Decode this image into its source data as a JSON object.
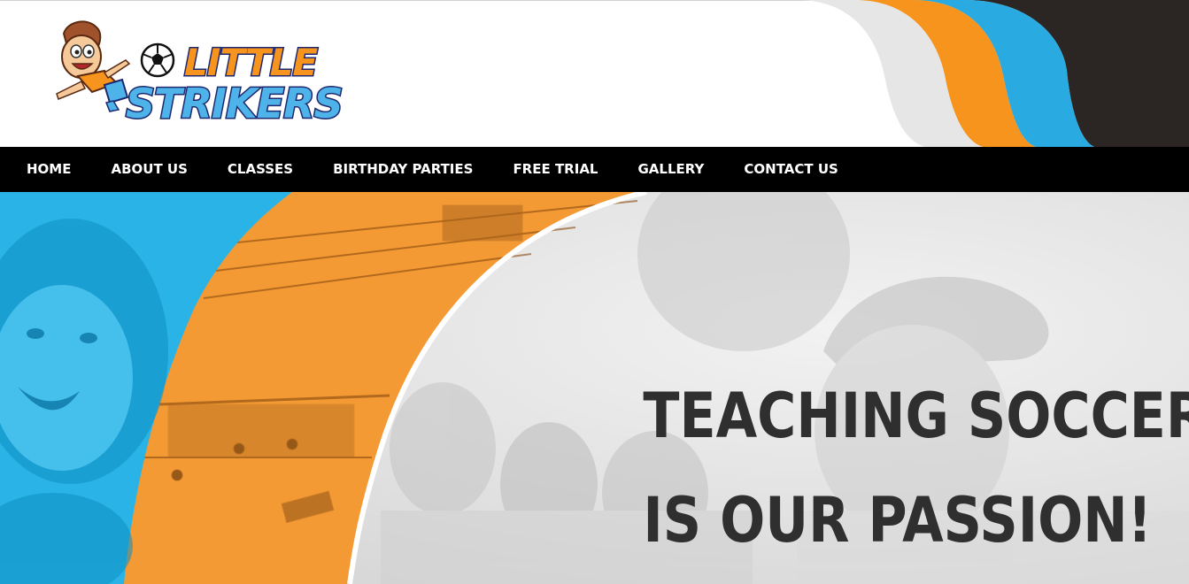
{
  "brand": {
    "logo_line1": "LITTLE",
    "logo_line2": "STRIKERS",
    "logo_icons": [
      "cartoon-boy-kicking",
      "soccer-ball-icon"
    ]
  },
  "header_wave_colors": [
    "#e6e6e6",
    "#f7941d",
    "#29abe2",
    "#2b2623"
  ],
  "nav": {
    "items": [
      {
        "label": "HOME"
      },
      {
        "label": "ABOUT US"
      },
      {
        "label": "CLASSES"
      },
      {
        "label": "BIRTHDAY PARTIES"
      },
      {
        "label": "FREE TRIAL"
      },
      {
        "label": "GALLERY"
      },
      {
        "label": "CONTACT US"
      }
    ]
  },
  "hero": {
    "headline_line1": "TEACHING SOCCER",
    "headline_line2": "IS OUR PASSION!"
  },
  "colors": {
    "nav_bg": "#000000",
    "accent_orange": "#f7941d",
    "accent_blue": "#29abe2",
    "dark": "#2b2623",
    "headline": "#2f2f2f"
  }
}
